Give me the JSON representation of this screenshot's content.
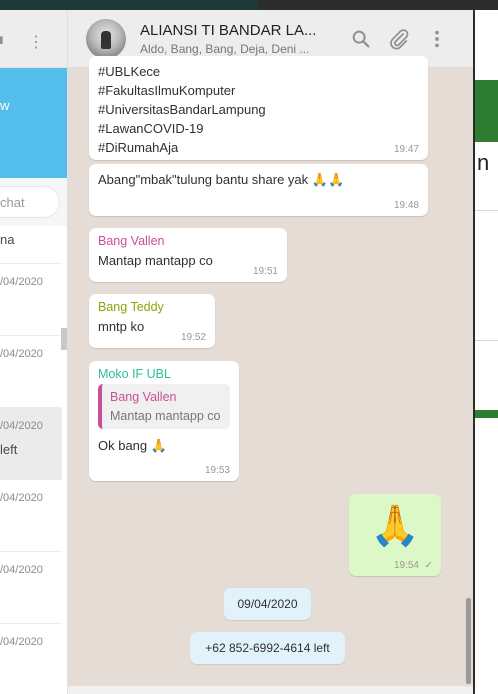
{
  "left_panel": {
    "notice_text": "w",
    "search_placeholder": "chat",
    "items": [
      {
        "date": "",
        "sub": "na"
      },
      {
        "date": "/04/2020",
        "sub": ""
      },
      {
        "date": "/04/2020",
        "sub": ""
      },
      {
        "date": "/04/2020",
        "sub": "left"
      },
      {
        "date": "/04/2020",
        "sub": ""
      },
      {
        "date": "/04/2020",
        "sub": ""
      },
      {
        "date": "/04/2020",
        "sub": ""
      }
    ]
  },
  "conversation": {
    "title": "ALIANSI TI BANDAR LA...",
    "subtitle": "Aldo, Bang, Bang, Deja, Deni ...",
    "messages": [
      {
        "lines": [
          "#UBLKece",
          "#FakultasIlmuKomputer",
          "#UniversitasBandarLampung",
          "#LawanCOVID-19",
          "#DiRumahAja"
        ],
        "time": "19:47"
      },
      {
        "text": "Abang\"mbak\"tulung bantu share yak 🙏🙏",
        "time": "19:48"
      },
      {
        "author": "Bang Vallen",
        "author_color": "#c94f9b",
        "text": "Mantap mantapp co",
        "time": "19:51"
      },
      {
        "author": "Bang Teddy",
        "author_color": "#8fa40b",
        "text": "mntp ko",
        "time": "19:52"
      },
      {
        "author": "Moko IF UBL",
        "author_color": "#2dbd9b",
        "quote_author": "Bang Vallen",
        "quote_text": "Mantap mantapp co",
        "text": "Ok bang 🙏",
        "time": "19:53"
      },
      {
        "emoji": "🙏",
        "time": "19:54",
        "status": "✓"
      }
    ],
    "system": [
      {
        "text": "09/04/2020"
      },
      {
        "text": "+62 852-6992-4614 left"
      }
    ]
  },
  "right_panel": {
    "letter": "n"
  },
  "icons": [
    "menu-icon",
    "search-icon",
    "attach-icon",
    "more-icon"
  ]
}
